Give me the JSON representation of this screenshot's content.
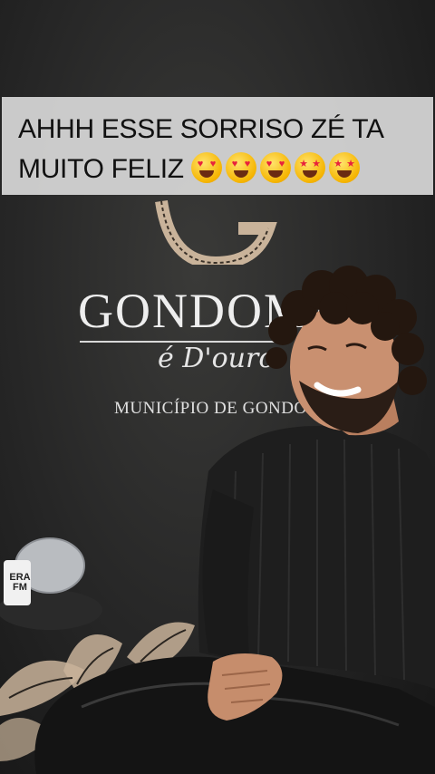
{
  "caption": {
    "line1": "AHHH ESSE SORRISO ZÉ TA",
    "line2": "MUITO FELIZ",
    "emojis": [
      "heart-eyes",
      "heart-eyes",
      "heart-eyes",
      "star-struck",
      "star-struck"
    ]
  },
  "backdrop": {
    "brand": "GONDOMA",
    "slogan": "é D'ouro",
    "municipio": "MUNICÍPIO DE GONDOMA",
    "colors": {
      "wall": "#262626",
      "text": "#eeeeee",
      "gold": "#c9b39a"
    }
  },
  "microphone": {
    "label_line1": "ERA",
    "label_line2": "FM"
  }
}
